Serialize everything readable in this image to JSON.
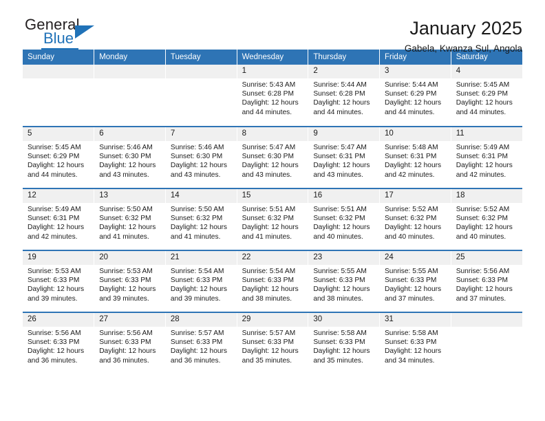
{
  "brand": {
    "name_top": "General",
    "name_bottom": "Blue",
    "accent_color": "#2072b8"
  },
  "header": {
    "title": "January 2025",
    "subtitle": "Gabela, Kwanza Sul, Angola"
  },
  "theme": {
    "header_row_color": "#2e74b5",
    "daynum_band_color": "#f0f0f0",
    "text_color": "#1a1a1a"
  },
  "weekdays": [
    "Sunday",
    "Monday",
    "Tuesday",
    "Wednesday",
    "Thursday",
    "Friday",
    "Saturday"
  ],
  "labels": {
    "sunrise_prefix": "Sunrise: ",
    "sunset_prefix": "Sunset: ",
    "daylight_prefix": "Daylight: "
  },
  "weeks": [
    [
      {
        "day": "",
        "empty": true
      },
      {
        "day": "",
        "empty": true
      },
      {
        "day": "",
        "empty": true
      },
      {
        "day": "1",
        "sunrise": "Sunrise: 5:43 AM",
        "sunset": "Sunset: 6:28 PM",
        "daylight_1": "Daylight: 12 hours",
        "daylight_2": "and 44 minutes."
      },
      {
        "day": "2",
        "sunrise": "Sunrise: 5:44 AM",
        "sunset": "Sunset: 6:28 PM",
        "daylight_1": "Daylight: 12 hours",
        "daylight_2": "and 44 minutes."
      },
      {
        "day": "3",
        "sunrise": "Sunrise: 5:44 AM",
        "sunset": "Sunset: 6:29 PM",
        "daylight_1": "Daylight: 12 hours",
        "daylight_2": "and 44 minutes."
      },
      {
        "day": "4",
        "sunrise": "Sunrise: 5:45 AM",
        "sunset": "Sunset: 6:29 PM",
        "daylight_1": "Daylight: 12 hours",
        "daylight_2": "and 44 minutes."
      }
    ],
    [
      {
        "day": "5",
        "sunrise": "Sunrise: 5:45 AM",
        "sunset": "Sunset: 6:29 PM",
        "daylight_1": "Daylight: 12 hours",
        "daylight_2": "and 44 minutes."
      },
      {
        "day": "6",
        "sunrise": "Sunrise: 5:46 AM",
        "sunset": "Sunset: 6:30 PM",
        "daylight_1": "Daylight: 12 hours",
        "daylight_2": "and 43 minutes."
      },
      {
        "day": "7",
        "sunrise": "Sunrise: 5:46 AM",
        "sunset": "Sunset: 6:30 PM",
        "daylight_1": "Daylight: 12 hours",
        "daylight_2": "and 43 minutes."
      },
      {
        "day": "8",
        "sunrise": "Sunrise: 5:47 AM",
        "sunset": "Sunset: 6:30 PM",
        "daylight_1": "Daylight: 12 hours",
        "daylight_2": "and 43 minutes."
      },
      {
        "day": "9",
        "sunrise": "Sunrise: 5:47 AM",
        "sunset": "Sunset: 6:31 PM",
        "daylight_1": "Daylight: 12 hours",
        "daylight_2": "and 43 minutes."
      },
      {
        "day": "10",
        "sunrise": "Sunrise: 5:48 AM",
        "sunset": "Sunset: 6:31 PM",
        "daylight_1": "Daylight: 12 hours",
        "daylight_2": "and 42 minutes."
      },
      {
        "day": "11",
        "sunrise": "Sunrise: 5:49 AM",
        "sunset": "Sunset: 6:31 PM",
        "daylight_1": "Daylight: 12 hours",
        "daylight_2": "and 42 minutes."
      }
    ],
    [
      {
        "day": "12",
        "sunrise": "Sunrise: 5:49 AM",
        "sunset": "Sunset: 6:31 PM",
        "daylight_1": "Daylight: 12 hours",
        "daylight_2": "and 42 minutes."
      },
      {
        "day": "13",
        "sunrise": "Sunrise: 5:50 AM",
        "sunset": "Sunset: 6:32 PM",
        "daylight_1": "Daylight: 12 hours",
        "daylight_2": "and 41 minutes."
      },
      {
        "day": "14",
        "sunrise": "Sunrise: 5:50 AM",
        "sunset": "Sunset: 6:32 PM",
        "daylight_1": "Daylight: 12 hours",
        "daylight_2": "and 41 minutes."
      },
      {
        "day": "15",
        "sunrise": "Sunrise: 5:51 AM",
        "sunset": "Sunset: 6:32 PM",
        "daylight_1": "Daylight: 12 hours",
        "daylight_2": "and 41 minutes."
      },
      {
        "day": "16",
        "sunrise": "Sunrise: 5:51 AM",
        "sunset": "Sunset: 6:32 PM",
        "daylight_1": "Daylight: 12 hours",
        "daylight_2": "and 40 minutes."
      },
      {
        "day": "17",
        "sunrise": "Sunrise: 5:52 AM",
        "sunset": "Sunset: 6:32 PM",
        "daylight_1": "Daylight: 12 hours",
        "daylight_2": "and 40 minutes."
      },
      {
        "day": "18",
        "sunrise": "Sunrise: 5:52 AM",
        "sunset": "Sunset: 6:32 PM",
        "daylight_1": "Daylight: 12 hours",
        "daylight_2": "and 40 minutes."
      }
    ],
    [
      {
        "day": "19",
        "sunrise": "Sunrise: 5:53 AM",
        "sunset": "Sunset: 6:33 PM",
        "daylight_1": "Daylight: 12 hours",
        "daylight_2": "and 39 minutes."
      },
      {
        "day": "20",
        "sunrise": "Sunrise: 5:53 AM",
        "sunset": "Sunset: 6:33 PM",
        "daylight_1": "Daylight: 12 hours",
        "daylight_2": "and 39 minutes."
      },
      {
        "day": "21",
        "sunrise": "Sunrise: 5:54 AM",
        "sunset": "Sunset: 6:33 PM",
        "daylight_1": "Daylight: 12 hours",
        "daylight_2": "and 39 minutes."
      },
      {
        "day": "22",
        "sunrise": "Sunrise: 5:54 AM",
        "sunset": "Sunset: 6:33 PM",
        "daylight_1": "Daylight: 12 hours",
        "daylight_2": "and 38 minutes."
      },
      {
        "day": "23",
        "sunrise": "Sunrise: 5:55 AM",
        "sunset": "Sunset: 6:33 PM",
        "daylight_1": "Daylight: 12 hours",
        "daylight_2": "and 38 minutes."
      },
      {
        "day": "24",
        "sunrise": "Sunrise: 5:55 AM",
        "sunset": "Sunset: 6:33 PM",
        "daylight_1": "Daylight: 12 hours",
        "daylight_2": "and 37 minutes."
      },
      {
        "day": "25",
        "sunrise": "Sunrise: 5:56 AM",
        "sunset": "Sunset: 6:33 PM",
        "daylight_1": "Daylight: 12 hours",
        "daylight_2": "and 37 minutes."
      }
    ],
    [
      {
        "day": "26",
        "sunrise": "Sunrise: 5:56 AM",
        "sunset": "Sunset: 6:33 PM",
        "daylight_1": "Daylight: 12 hours",
        "daylight_2": "and 36 minutes."
      },
      {
        "day": "27",
        "sunrise": "Sunrise: 5:56 AM",
        "sunset": "Sunset: 6:33 PM",
        "daylight_1": "Daylight: 12 hours",
        "daylight_2": "and 36 minutes."
      },
      {
        "day": "28",
        "sunrise": "Sunrise: 5:57 AM",
        "sunset": "Sunset: 6:33 PM",
        "daylight_1": "Daylight: 12 hours",
        "daylight_2": "and 36 minutes."
      },
      {
        "day": "29",
        "sunrise": "Sunrise: 5:57 AM",
        "sunset": "Sunset: 6:33 PM",
        "daylight_1": "Daylight: 12 hours",
        "daylight_2": "and 35 minutes."
      },
      {
        "day": "30",
        "sunrise": "Sunrise: 5:58 AM",
        "sunset": "Sunset: 6:33 PM",
        "daylight_1": "Daylight: 12 hours",
        "daylight_2": "and 35 minutes."
      },
      {
        "day": "31",
        "sunrise": "Sunrise: 5:58 AM",
        "sunset": "Sunset: 6:33 PM",
        "daylight_1": "Daylight: 12 hours",
        "daylight_2": "and 34 minutes."
      },
      {
        "day": "",
        "empty": true
      }
    ]
  ]
}
